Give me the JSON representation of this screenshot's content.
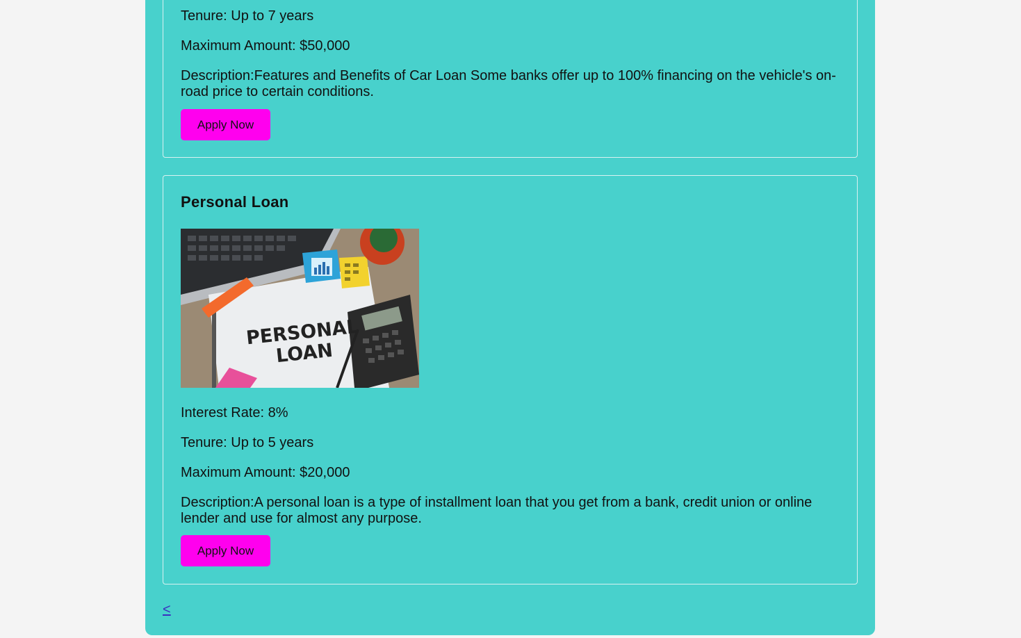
{
  "car_loan": {
    "tenure": "Tenure: Up to 7 years",
    "max_amount": "Maximum Amount: $50,000",
    "description": "Description:Features and Benefits of Car Loan Some banks offer up to 100% financing on the vehicle's on-road price to certain conditions.",
    "apply_label": "Apply Now"
  },
  "personal_loan": {
    "title": "Personal Loan",
    "image_alt": "Personal loan",
    "image_text_line1": "PERSONAL",
    "image_text_line2": "LOAN",
    "interest_rate": "Interest Rate: 8%",
    "tenure": "Tenure: Up to 5 years",
    "max_amount": "Maximum Amount: $20,000",
    "description": "Description:A personal loan is a type of installment loan that you get from a bank, credit union or online lender and use for almost any purpose.",
    "apply_label": "Apply Now"
  },
  "pagination": {
    "back_label": "<"
  },
  "colors": {
    "container": "#48d1cc",
    "button": "#ff00ee",
    "link": "#3a2fc0"
  }
}
